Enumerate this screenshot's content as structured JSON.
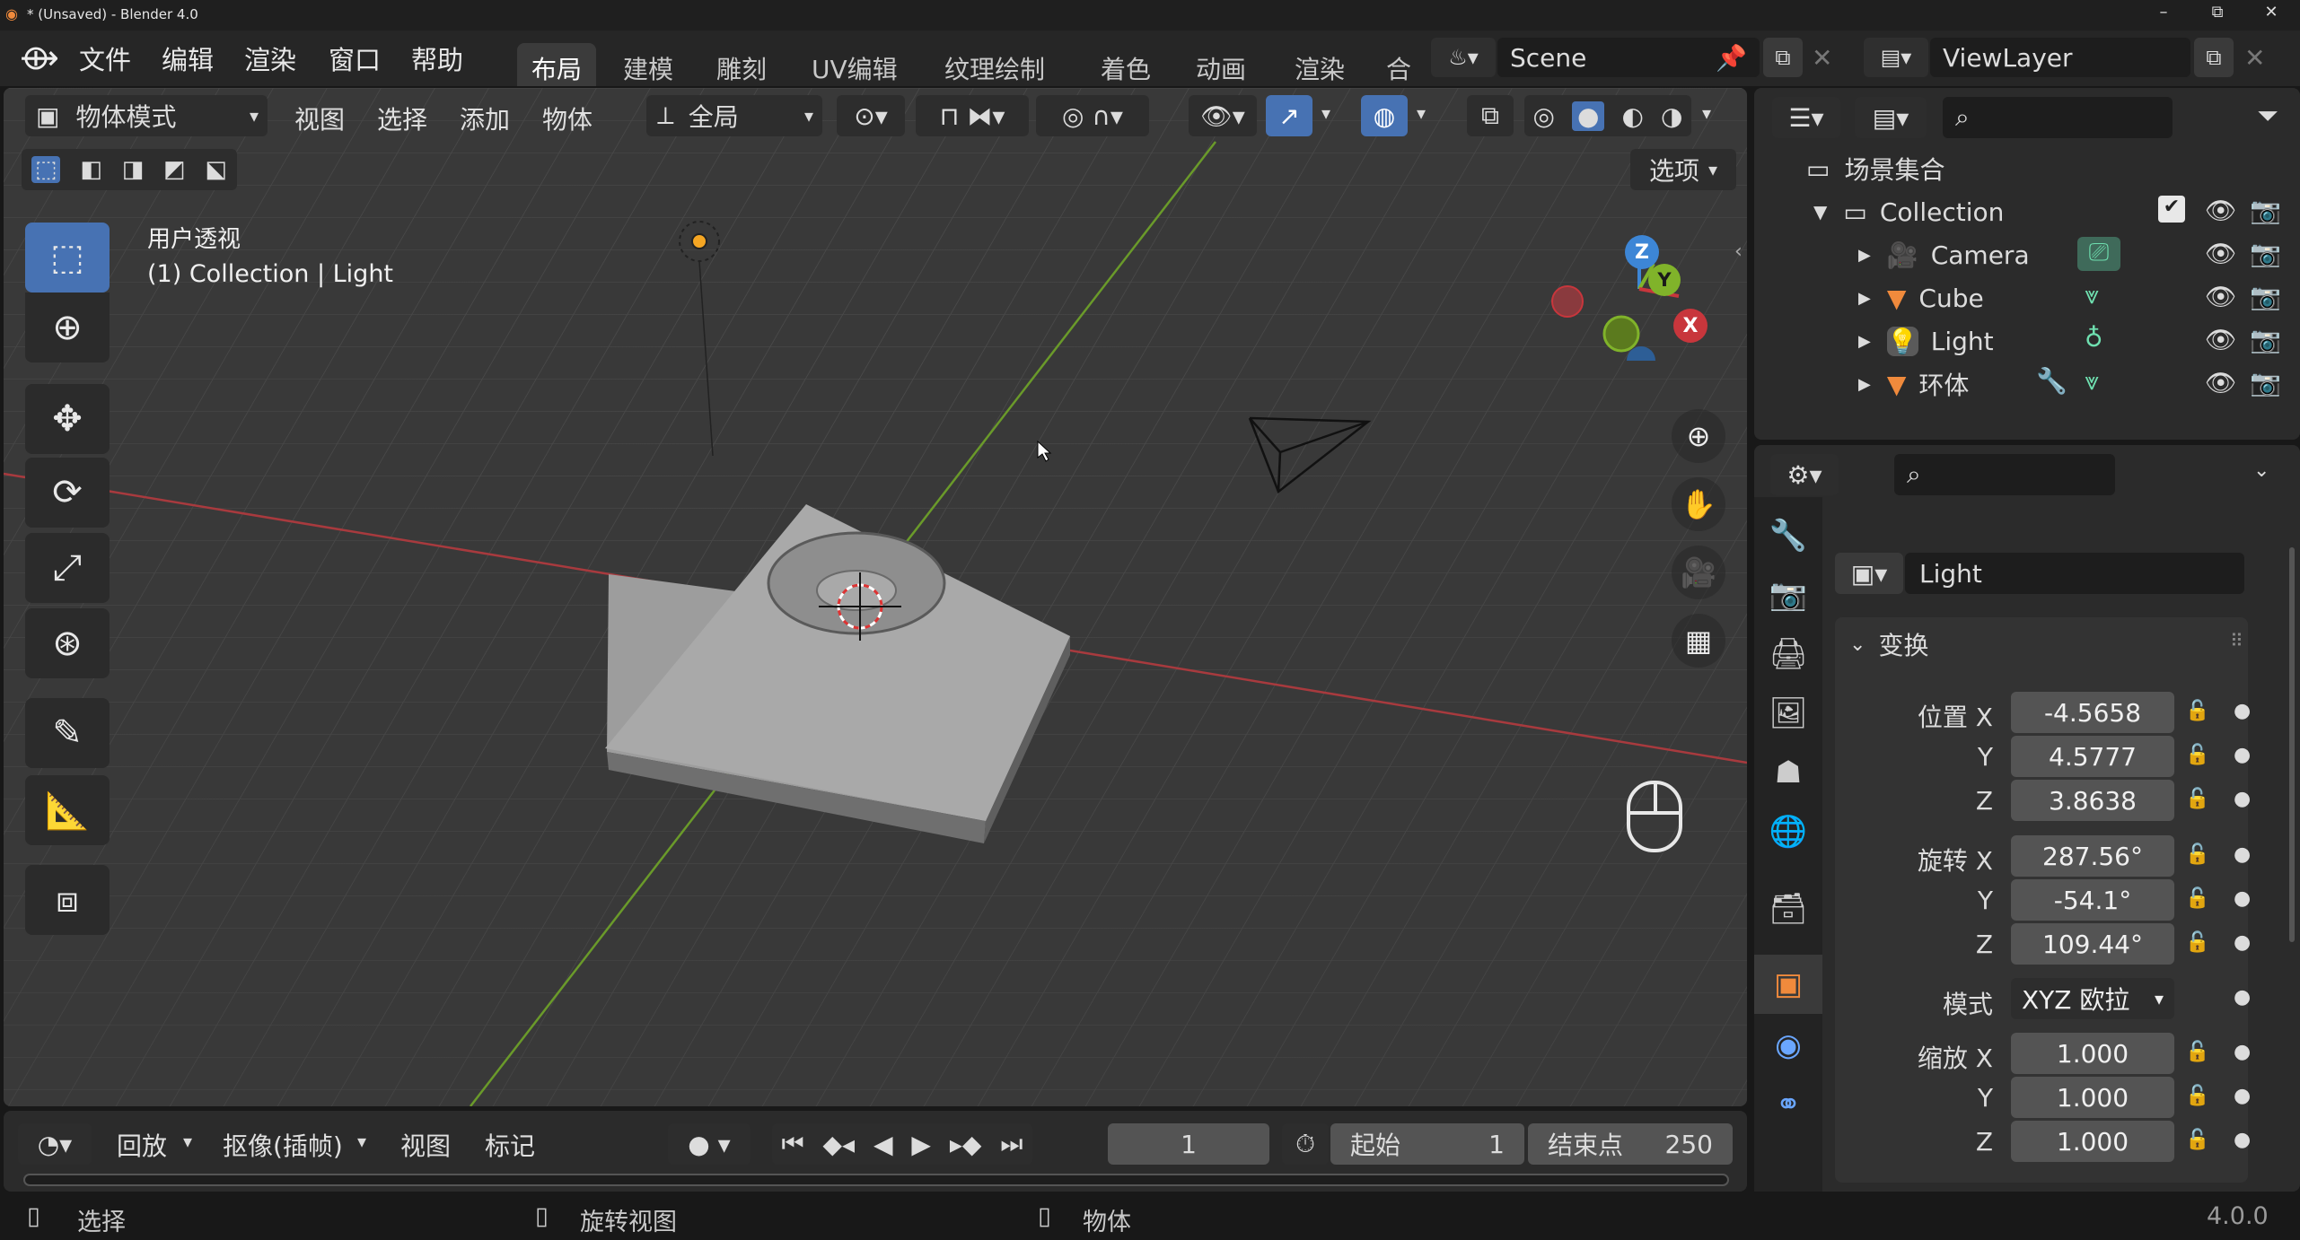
{
  "window": {
    "title": "* (Unsaved) - Blender 4.0",
    "minimize": "–",
    "maximize": "⧉",
    "close": "✕"
  },
  "menu": {
    "file": "文件",
    "edit": "编辑",
    "render": "渲染",
    "window": "窗口",
    "help": "帮助"
  },
  "workspaces": [
    "布局",
    "建模",
    "雕刻",
    "UV编辑",
    "纹理绘制",
    "着色",
    "动画",
    "渲染",
    "合成"
  ],
  "scene": {
    "name": "Scene",
    "view_layer": "ViewLayer"
  },
  "viewport_header": {
    "mode": "物体模式",
    "view": "视图",
    "select": "选择",
    "add": "添加",
    "object": "物体",
    "orientation": "全局",
    "options": "选项"
  },
  "viewport": {
    "perspective": "用户透视",
    "collection_info": "(1) Collection | Light"
  },
  "gizmo": {
    "z": "Z",
    "y": "Y",
    "x": "X"
  },
  "timeline": {
    "playback": "回放",
    "keying": "抠像(插帧)",
    "view": "视图",
    "marker": "标记",
    "current_frame": "1",
    "start_label": "起始",
    "start": "1",
    "end_label": "结束点",
    "end": "250"
  },
  "statusbar": {
    "select": "选择",
    "rotate_view": "旋转视图",
    "object": "物体",
    "version": "4.0.0"
  },
  "outliner": {
    "scene_collection": "场景集合",
    "collection": "Collection",
    "items": [
      {
        "name": "Camera",
        "icon": "camera-icon",
        "color": "#e8a05a"
      },
      {
        "name": "Cube",
        "icon": "mesh-icon",
        "color": "#f08a3c"
      },
      {
        "name": "Light",
        "icon": "light-icon",
        "color": "#e8a05a"
      },
      {
        "name": "环体",
        "icon": "mesh-icon",
        "color": "#f08a3c"
      }
    ]
  },
  "properties": {
    "object_name": "Light",
    "panel_title": "变换",
    "location_label": "位置 X",
    "location": {
      "x": "-4.5658",
      "y": "4.5777",
      "z": "3.8638"
    },
    "rotation_label": "旋转 X",
    "rotation": {
      "x": "287.56°",
      "y": "-54.1°",
      "z": "109.44°"
    },
    "mode_label": "模式",
    "mode": "XYZ 欧拉",
    "scale_label": "缩放 X",
    "scale": {
      "x": "1.000",
      "y": "1.000",
      "z": "1.000"
    },
    "y_label": "Y",
    "z_label": "Z"
  },
  "colors": {
    "accent": "#4772b3",
    "x_axis": "#c8363c",
    "y_axis": "#80b32a",
    "z_axis": "#3d86d6",
    "orange": "#f08a3c"
  }
}
